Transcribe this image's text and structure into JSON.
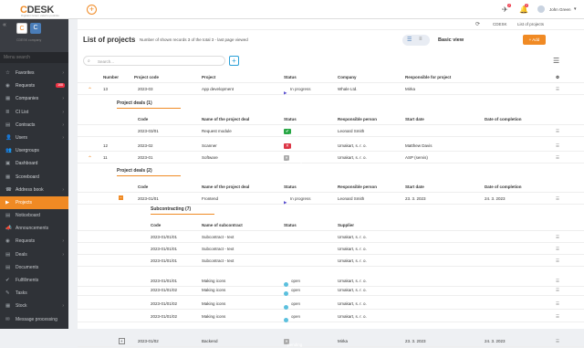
{
  "top": {
    "brand_c": "C",
    "brand_rest": "DESK",
    "brand_sub": "Digitální řešení vašeho podniku",
    "user": "John Green",
    "bell_count": "2",
    "alert_count": "2"
  },
  "sidebar": {
    "company": "CDESK company",
    "menu_search": "Menu search",
    "items": [
      {
        "label": "Favorites"
      },
      {
        "label": "Requests",
        "count": "168"
      },
      {
        "label": "Companies"
      },
      {
        "label": "CI List"
      },
      {
        "label": "Contracts"
      },
      {
        "label": "Users"
      },
      {
        "label": "Usergroups"
      },
      {
        "label": "Dashboard"
      },
      {
        "label": "Scoreboard"
      },
      {
        "label": "Address book"
      },
      {
        "label": "Projects"
      },
      {
        "label": "Noticeboard"
      },
      {
        "label": "Announcements"
      },
      {
        "label": "Requests"
      },
      {
        "label": "Deals"
      },
      {
        "label": "Documents"
      },
      {
        "label": "Fulfillments"
      },
      {
        "label": "Tasks"
      },
      {
        "label": "Stock"
      },
      {
        "label": "Message processing"
      }
    ]
  },
  "breadcrumb": {
    "root": "CDESK",
    "current": "List of projects"
  },
  "page": {
    "title": "List of projects",
    "info": "Number of shown records 3 of the total 3 - last page viewed",
    "view": "Basic view",
    "add": "+ Add",
    "search_placeholder": "Search..."
  },
  "columns": {
    "number": "Number",
    "code": "Project code",
    "project": "Project",
    "status": "Status",
    "company": "Company",
    "responsible": "Responsible for project"
  },
  "deal_columns": {
    "code": "Code",
    "name": "Name of the project deal",
    "status": "Status",
    "person": "Responsible person",
    "start": "Start date",
    "end": "Date of completion"
  },
  "sub_columns": {
    "code": "Code",
    "name": "Name of subcontract",
    "status": "Status",
    "supplier": "Supplier"
  },
  "projects": [
    {
      "num": "13",
      "code": "2023-03",
      "name": "App development",
      "status": "In progress",
      "company": "Whale Ltd.",
      "resp": "Mirka"
    },
    {
      "num": "12",
      "code": "2023-02",
      "name": "Scanner",
      "status": "canceled",
      "company": "Umakart, s. r. o.",
      "resp": "Matthew Davis"
    },
    {
      "num": "11",
      "code": "2023-01",
      "name": "Software",
      "status": "pending",
      "company": "Umakart, s. r. o.",
      "resp": "ASP (servis)"
    }
  ],
  "deals1": {
    "title": "Project deals (1)",
    "rows": [
      {
        "code": "2023-03/01",
        "name": "Request module",
        "status": "completed",
        "person": "Leonard Smith",
        "start": "",
        "end": ""
      }
    ]
  },
  "deals2": {
    "title": "Project deals (2)",
    "rows": [
      {
        "code": "2023-01/01",
        "name": "Frontend",
        "status": "In progress",
        "person": "Leonard Smith",
        "start": "23. 3. 2023",
        "end": "24. 3. 2023"
      },
      {
        "code": "2023-01/02",
        "name": "Backend",
        "status": "pending",
        "person": "Mirka",
        "start": "23. 3. 2023",
        "end": "24. 3. 2023"
      }
    ]
  },
  "subcontracting": {
    "title": "Subcontracting (7)",
    "rows": [
      {
        "code": "2023-01/01/01",
        "name": "Subcontract - text",
        "status": "",
        "supplier": "Umakart, s. r. o."
      },
      {
        "code": "2023-01/01/01",
        "name": "Subcontract - text",
        "status": "",
        "supplier": "Umakart, s. r. o."
      },
      {
        "code": "2023-01/01/01",
        "name": "Subcontract - text",
        "status": "",
        "supplier": "Umakart, s. r. o."
      },
      {
        "code": "2023-01/01/01",
        "name": "Making icons",
        "status": "open",
        "supplier": "Umakart, s. r. o."
      },
      {
        "code": "2023-01/01/02",
        "name": "Making icons",
        "status": "open",
        "supplier": "Umakart, s. r. o."
      },
      {
        "code": "2023-01/01/02",
        "name": "Making icons",
        "status": "open",
        "supplier": "Umakart, s. r. o."
      },
      {
        "code": "2023-01/01/02",
        "name": "Making icons",
        "status": "open",
        "supplier": "Umakart, s. r. o."
      }
    ]
  }
}
